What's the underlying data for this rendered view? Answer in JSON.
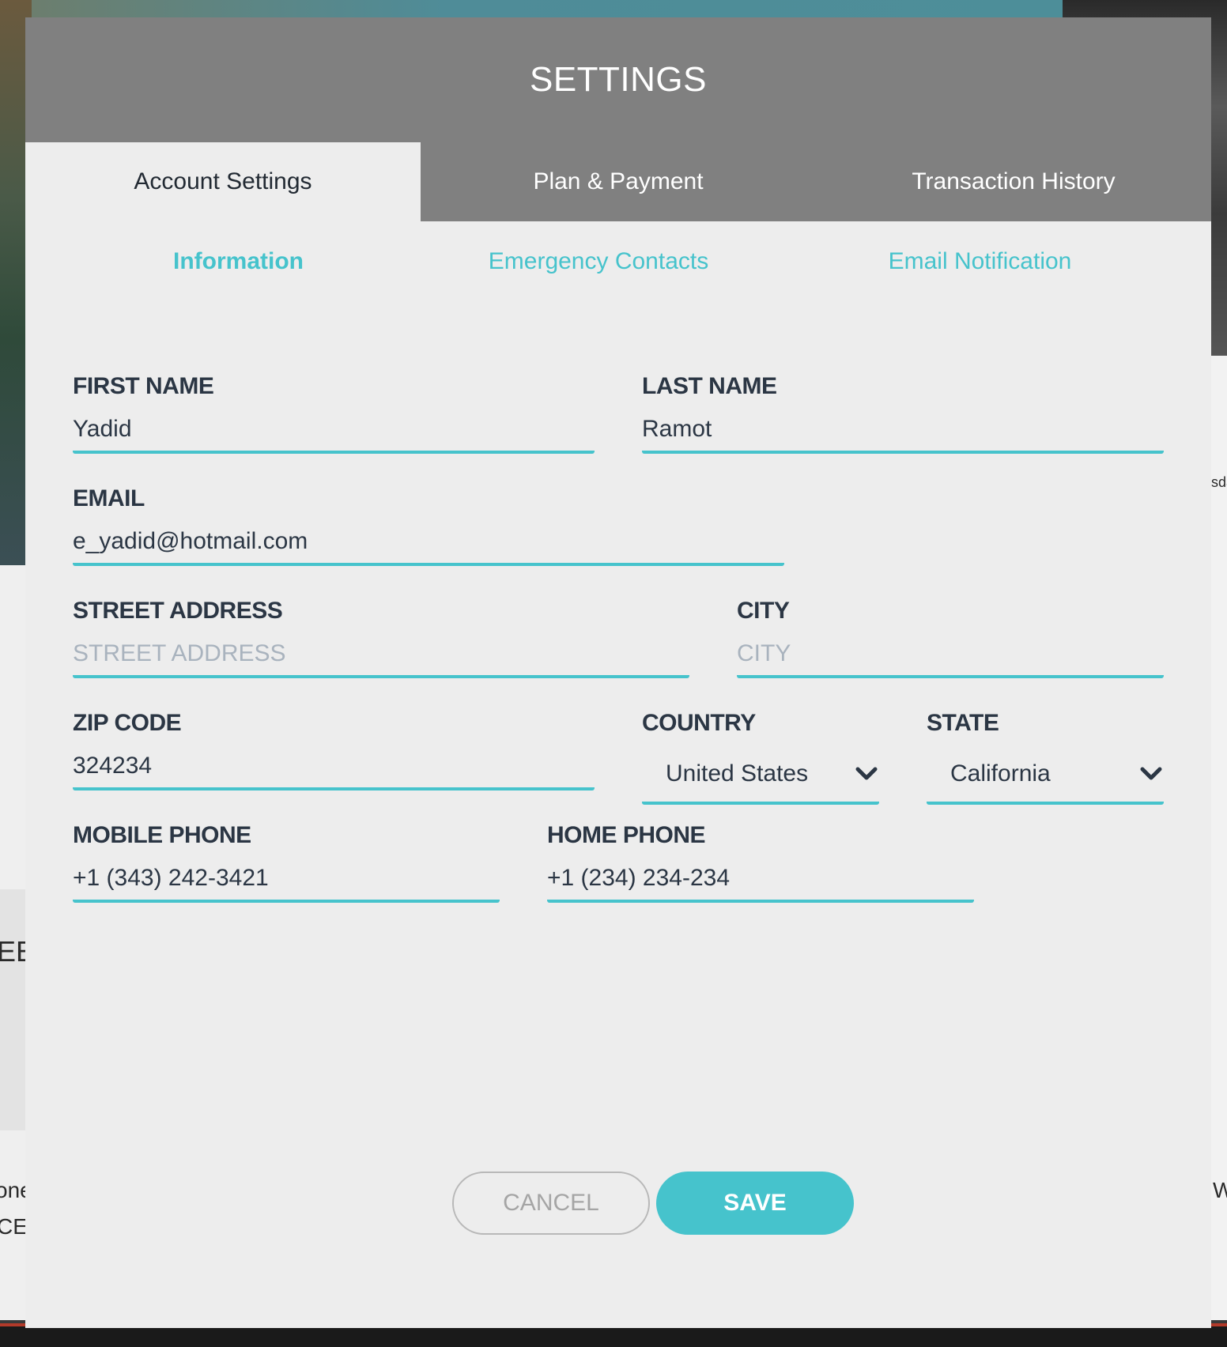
{
  "modal": {
    "title": "SETTINGS"
  },
  "tabs": [
    {
      "label": "Account Settings",
      "active": true
    },
    {
      "label": "Plan & Payment",
      "active": false
    },
    {
      "label": "Transaction History",
      "active": false
    }
  ],
  "subtabs": [
    {
      "label": "Information",
      "active": true
    },
    {
      "label": "Emergency Contacts",
      "active": false
    },
    {
      "label": "Email Notification",
      "active": false
    }
  ],
  "form": {
    "first_name": {
      "label": "FIRST NAME",
      "value": "Yadid",
      "placeholder": ""
    },
    "last_name": {
      "label": "LAST NAME",
      "value": "Ramot",
      "placeholder": ""
    },
    "email": {
      "label": "EMAIL",
      "value": "e_yadid@hotmail.com",
      "placeholder": ""
    },
    "street_address": {
      "label": "STREET ADDRESS",
      "value": "",
      "placeholder": "STREET ADDRESS"
    },
    "city": {
      "label": "CITY",
      "value": "",
      "placeholder": "CITY"
    },
    "zip_code": {
      "label": "ZIP CODE",
      "value": "324234",
      "placeholder": ""
    },
    "country": {
      "label": "COUNTRY",
      "value": "United States"
    },
    "state": {
      "label": "STATE",
      "value": "California"
    },
    "mobile_phone": {
      "label": "MOBILE PHONE",
      "value": "+1 (343) 242-3421",
      "placeholder": ""
    },
    "home_phone": {
      "label": "HOME PHONE",
      "value": "+1 (234) 234-234",
      "placeholder": ""
    }
  },
  "buttons": {
    "cancel": "CANCEL",
    "save": "SAVE"
  },
  "background": {
    "left_fragment_1": "EE",
    "left_fragment_2": "one",
    "left_fragment_3": "CE",
    "right_fragment_1": "sda",
    "right_fragment_2": "W"
  },
  "colors": {
    "accent": "#46c3cc",
    "header_gray": "#808080",
    "modal_bg": "#ededed",
    "label_text": "#2b3644"
  }
}
